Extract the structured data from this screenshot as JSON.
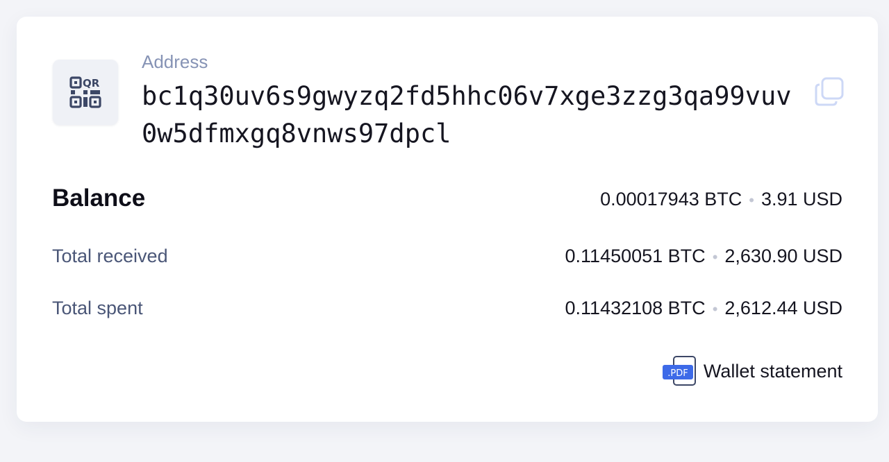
{
  "address": {
    "label": "Address",
    "value": "bc1q30uv6s9gwyzq2fd5hhc06v7xge3zzg3qa99vuv0w5dfmxgq8vnws97dpcl"
  },
  "qr": {
    "icon": "qr-code-icon"
  },
  "copy": {
    "icon": "copy-icon"
  },
  "balance": {
    "label": "Balance",
    "btc": "0.00017943 BTC",
    "usd": "3.91 USD"
  },
  "received": {
    "label": "Total received",
    "btc": "0.11450051 BTC",
    "usd": "2,630.90 USD"
  },
  "spent": {
    "label": "Total spent",
    "btc": "0.11432108 BTC",
    "usd": "2,612.44 USD"
  },
  "statement": {
    "label": "Wallet statement",
    "badge": ".PDF",
    "icon": "pdf-file-icon"
  },
  "colors": {
    "accent": "#3d6ae8",
    "label": "#4a5677",
    "muted": "#8693b5",
    "background": "#f3f4f8"
  }
}
